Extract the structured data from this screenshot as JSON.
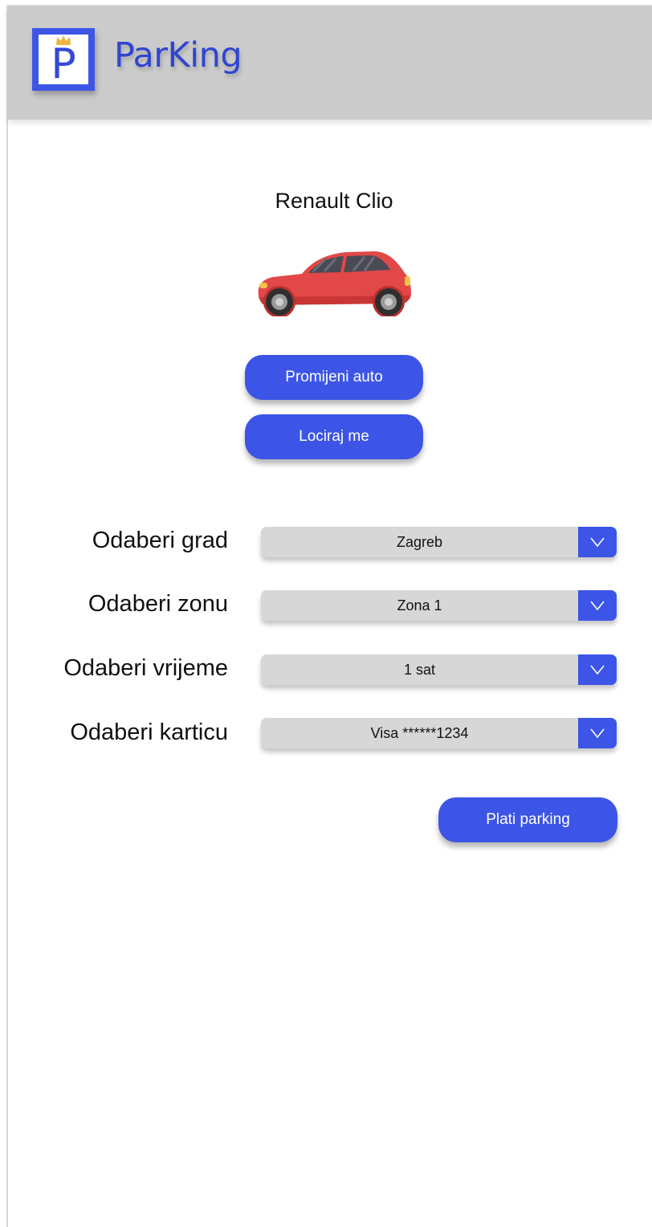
{
  "app": {
    "title": "ParKing",
    "logo_letter": "P"
  },
  "car": {
    "name": "Renault Clio",
    "image_icon": "red-hatchback-car-icon"
  },
  "buttons": {
    "change_car": "Promijeni auto",
    "locate_me": "Lociraj me",
    "pay": "Plati parking"
  },
  "form": {
    "city": {
      "label": "Odaberi grad",
      "value": "Zagreb"
    },
    "zone": {
      "label": "Odaberi zonu",
      "value": "Zona 1"
    },
    "time": {
      "label": "Odaberi vrijeme",
      "value": "1 sat"
    },
    "card": {
      "label": "Odaberi karticu",
      "value": "Visa ******1234"
    }
  },
  "colors": {
    "accent": "#3d55e6",
    "header_bg": "#cbcbcb",
    "select_bg": "#d7d7d7",
    "car_body": "#e24848",
    "crown": "#f0b43c"
  }
}
